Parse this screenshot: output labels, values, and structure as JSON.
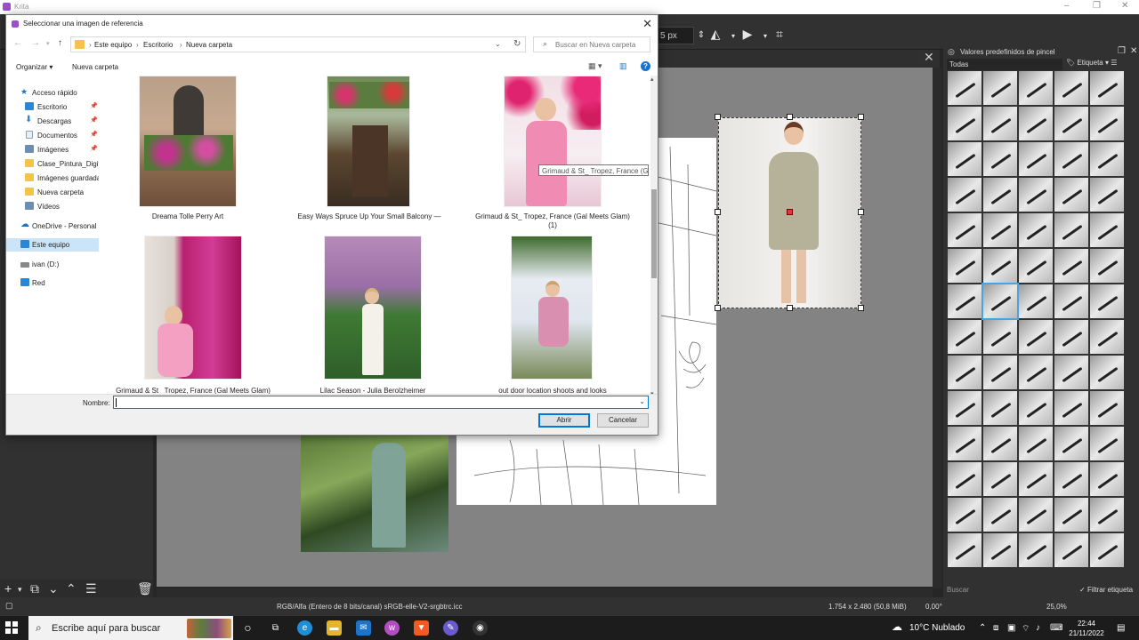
{
  "krita": {
    "title": "Krita",
    "size_field": "5 px",
    "brush_panel_title": "Valores predefinidos de pincel",
    "brush_filter": "Todas",
    "brush_tag": "Etiqueta",
    "brush_search_placeholder": "Buscar",
    "brush_filter_tag": "Filtrar etiqueta",
    "status_color": "RGB/Alfa (Entero de 8 bits/canal)  sRGB-elle-V2-srgbtrc.icc",
    "status_size": "1.754 x 2.480 (50,8 MiB)",
    "status_rotation": "0,00°",
    "status_zoom": "25,0%"
  },
  "dialog": {
    "title": "Seleccionar una imagen de referencia",
    "breadcrumb": [
      "Este equipo",
      "Escritorio",
      "Nueva carpeta"
    ],
    "search_placeholder": "Buscar en Nueva carpeta",
    "organize_label": "Organizar ▾",
    "new_folder_label": "Nueva carpeta",
    "tree": [
      {
        "label": "Acceso rápido",
        "icon": "star-icon",
        "color": "#1a73c8"
      },
      {
        "label": "Escritorio",
        "icon": "desktop-icon",
        "color": "#2b86d6"
      },
      {
        "label": "Descargas",
        "icon": "download-icon",
        "color": "#2b86d6"
      },
      {
        "label": "Documentos",
        "icon": "document-icon",
        "color": "#8aa0b5"
      },
      {
        "label": "Imágenes",
        "icon": "pictures-icon",
        "color": "#6a8fb0"
      },
      {
        "label": "Clase_Pintura_Digit",
        "icon": "folder-icon",
        "color": "#f5c34a"
      },
      {
        "label": "Imágenes guardada",
        "icon": "folder-icon",
        "color": "#f5c34a"
      },
      {
        "label": "Nueva carpeta",
        "icon": "folder-icon",
        "color": "#f5c34a"
      },
      {
        "label": "Vídeos",
        "icon": "video-icon",
        "color": "#6a8fb0"
      },
      {
        "label": "OneDrive - Personal",
        "icon": "cloud-icon",
        "color": "#1a73c8"
      },
      {
        "label": "Este equipo",
        "icon": "computer-icon",
        "color": "#2b86d6"
      },
      {
        "label": "ivan (D:)",
        "icon": "drive-icon",
        "color": "#888888"
      },
      {
        "label": "Red",
        "icon": "network-icon",
        "color": "#2b86d6"
      }
    ],
    "files": [
      {
        "caption": "Dreama Tolle Perry Art",
        "caption2": ""
      },
      {
        "caption": "Easy Ways Spruce Up Your Small Balcony —",
        "caption2": ""
      },
      {
        "caption": "Grimaud & St_ Tropez, France (Gal Meets Glam)",
        "caption2": "(1)"
      },
      {
        "caption": "Grimaud & St_ Tropez, France (Gal Meets Glam)",
        "caption2": ""
      },
      {
        "caption": "Lilac Season - Julia Berolzheimer",
        "caption2": ""
      },
      {
        "caption": "out door location shoots and looks",
        "caption2": ""
      }
    ],
    "tooltip": "Grimaud & St_ Tropez, France (G...",
    "name_label": "Nombre:",
    "name_value": "",
    "open_label": "Abrir",
    "cancel_label": "Cancelar"
  },
  "taskbar": {
    "search_placeholder": "Escribe aquí para buscar",
    "weather": "10°C  Nublado",
    "time": "22:44",
    "date": "21/11/2022"
  }
}
